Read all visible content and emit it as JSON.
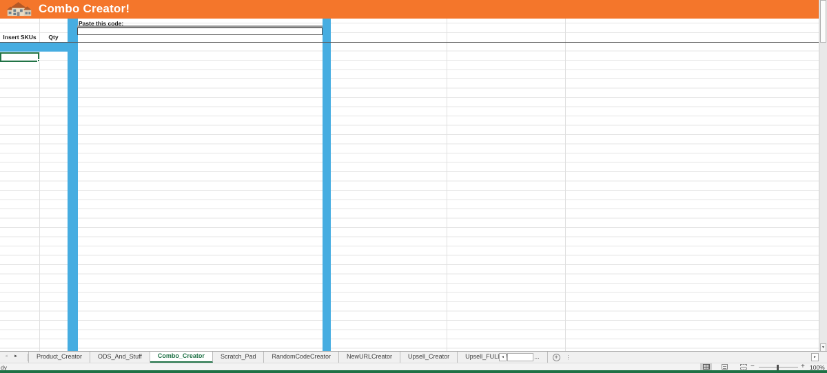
{
  "banner": {
    "title": "Combo Creator!"
  },
  "sheet": {
    "paste_label": "Paste this code:",
    "paste_value": "",
    "col_a_header": "Insert SKUs",
    "col_b_header": "Qty",
    "banner_orange": "#F4762B",
    "accent_blue": "#46ADE1",
    "selection_green": "#217346"
  },
  "tabs": {
    "items": [
      {
        "label": "Product_Creator",
        "active": false
      },
      {
        "label": "ODS_And_Stuff",
        "active": false
      },
      {
        "label": "Combo_Creator",
        "active": true
      },
      {
        "label": "Scratch_Pad",
        "active": false
      },
      {
        "label": "RandomCodeCreator",
        "active": false
      },
      {
        "label": "NewURLCreator",
        "active": false
      },
      {
        "label": "Upsell_Creator",
        "active": false
      },
      {
        "label": "Upsell_FULL_AutoCreat ...",
        "active": false
      }
    ]
  },
  "icons": {
    "tab_nav_left": "◄",
    "tab_nav_right": "►",
    "new_sheet": "+",
    "more_tabs": "⋮",
    "scroll_left": "◄",
    "scroll_right": "►",
    "scroll_down": "▼",
    "zoom_out": "−",
    "zoom_in": "+"
  },
  "statusbar": {
    "ready_text": "dy",
    "zoom_level": "100%"
  }
}
